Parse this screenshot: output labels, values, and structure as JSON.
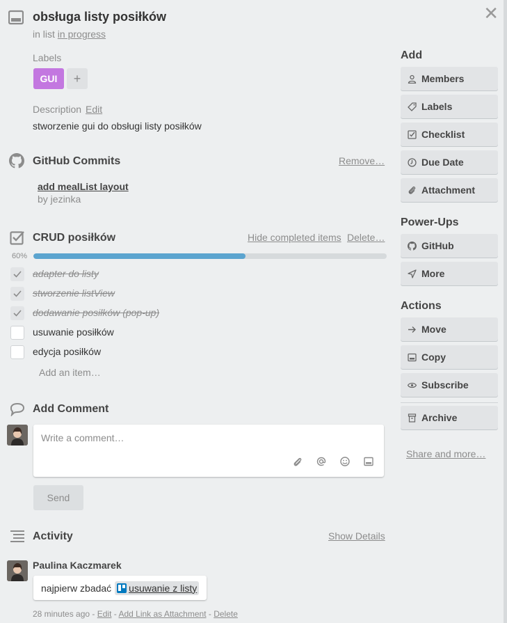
{
  "card": {
    "title": "obsługa listy posiłków",
    "in_list_prefix": "in list",
    "list_name": "in progress",
    "close_glyph": "✕"
  },
  "labels": {
    "heading": "Labels",
    "items": [
      {
        "name": "GUI",
        "color": "#c377e0"
      }
    ],
    "add_glyph": "+"
  },
  "description": {
    "heading": "Description",
    "edit_label": "Edit",
    "text": "stworzenie gui do obsługi listy posiłków"
  },
  "github": {
    "title": "GitHub Commits",
    "remove_label": "Remove…",
    "commit_title": "add mealList layout",
    "commit_by": "by jezinka"
  },
  "checklist": {
    "title": "CRUD posiłków",
    "hide_label": "Hide completed items",
    "delete_label": "Delete…",
    "progress_text": "60%",
    "progress": 0.6,
    "progress_color": "#5ba4cf",
    "items": [
      {
        "text": "adapter do listy",
        "done": true
      },
      {
        "text": "stworzenie listView",
        "done": true
      },
      {
        "text": "dodawanie posiłków (pop-up)",
        "done": true
      },
      {
        "text": "usuwanie posiłków",
        "done": false
      },
      {
        "text": "edycja posiłków",
        "done": false
      }
    ],
    "add_item_label": "Add an item…"
  },
  "comment": {
    "title": "Add Comment",
    "placeholder": "Write a comment…",
    "send_label": "Send",
    "tools": [
      "paperclip-icon",
      "at-icon",
      "emoji-icon",
      "card-icon"
    ]
  },
  "activity": {
    "title": "Activity",
    "show_details_label": "Show Details",
    "entry": {
      "author": "Paulina Kaczmarek",
      "text_prefix": "najpierw zbadać",
      "card_link": "usuwanie z listy",
      "time": "28 minutes ago",
      "sep": "-",
      "edit_label": "Edit",
      "attach_label": "Add Link as Attachment",
      "delete_label": "Delete"
    }
  },
  "sidebar": {
    "add_heading": "Add",
    "add_buttons": [
      {
        "label": "Members",
        "icon": "person-icon"
      },
      {
        "label": "Labels",
        "icon": "tag-icon"
      },
      {
        "label": "Checklist",
        "icon": "checkbox-icon"
      },
      {
        "label": "Due Date",
        "icon": "clock-icon"
      },
      {
        "label": "Attachment",
        "icon": "paperclip-icon"
      }
    ],
    "powerups_heading": "Power-Ups",
    "powerup_buttons": [
      {
        "label": "GitHub",
        "icon": "github-icon"
      },
      {
        "label": "More",
        "icon": "rocket-icon"
      }
    ],
    "actions_heading": "Actions",
    "action_buttons": [
      {
        "label": "Move",
        "icon": "arrow-right-icon"
      },
      {
        "label": "Copy",
        "icon": "card-icon"
      },
      {
        "label": "Subscribe",
        "icon": "eye-icon"
      },
      {
        "label": "Archive",
        "icon": "archive-icon"
      }
    ],
    "share_label": "Share and more…"
  }
}
